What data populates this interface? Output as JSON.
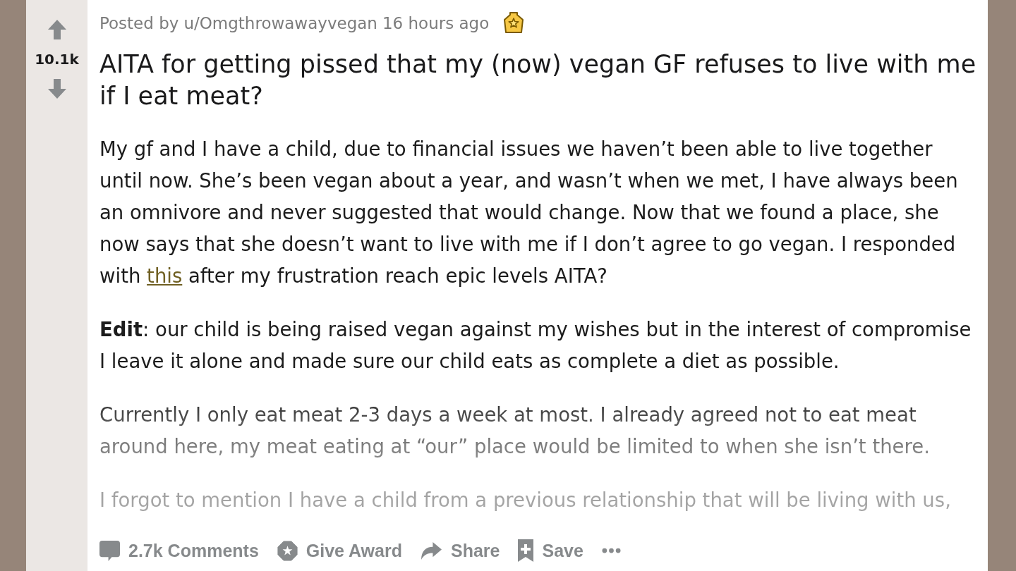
{
  "vote": {
    "score": "10.1k"
  },
  "post": {
    "byline": {
      "prefix": "Posted by",
      "author": "u/Omgthrowawayvegan",
      "time": "16 hours ago"
    },
    "title": "AITA for getting pissed that my (now) vegan GF refuses to live with me if I eat meat?",
    "paragraphs": [
      {
        "parts": [
          {
            "kind": "text",
            "text": "My gf and I have a child, due to financial issues we haven’t been able to live together until now. She’s been vegan about a year, and wasn’t when we met, I have always been an omnivore and never suggested that would change. Now that we found a place, she now says that she doesn’t want to live with me if I don’t agree to go vegan. I responded with "
          },
          {
            "kind": "link",
            "text": "this"
          },
          {
            "kind": "text",
            "text": " after my frustration reach epic levels AITA?"
          }
        ]
      },
      {
        "parts": [
          {
            "kind": "text",
            "text": "**Edit**: our child is being raised vegan against my wishes but in the interest of compromise I leave it alone and made sure our child eats as complete a diet as possible."
          }
        ]
      },
      {
        "parts": [
          {
            "kind": "text",
            "text": "Currently I only eat meat 2-3 days a week at most. I already agreed not to eat meat around here, my meat eating at “our” place would be limited to when she isn’t there."
          }
        ]
      },
      {
        "parts": [
          {
            "kind": "text",
            "text": "I forgot to mention I have a child from a previous relationship that will be living with us,"
          }
        ]
      }
    ]
  },
  "actions": [
    {
      "kind": "comments",
      "label": "2.7k Comments"
    },
    {
      "kind": "award",
      "label": "Give Award"
    },
    {
      "kind": "share",
      "label": "Share"
    },
    {
      "kind": "save",
      "label": "Save"
    },
    {
      "kind": "more"
    }
  ]
}
